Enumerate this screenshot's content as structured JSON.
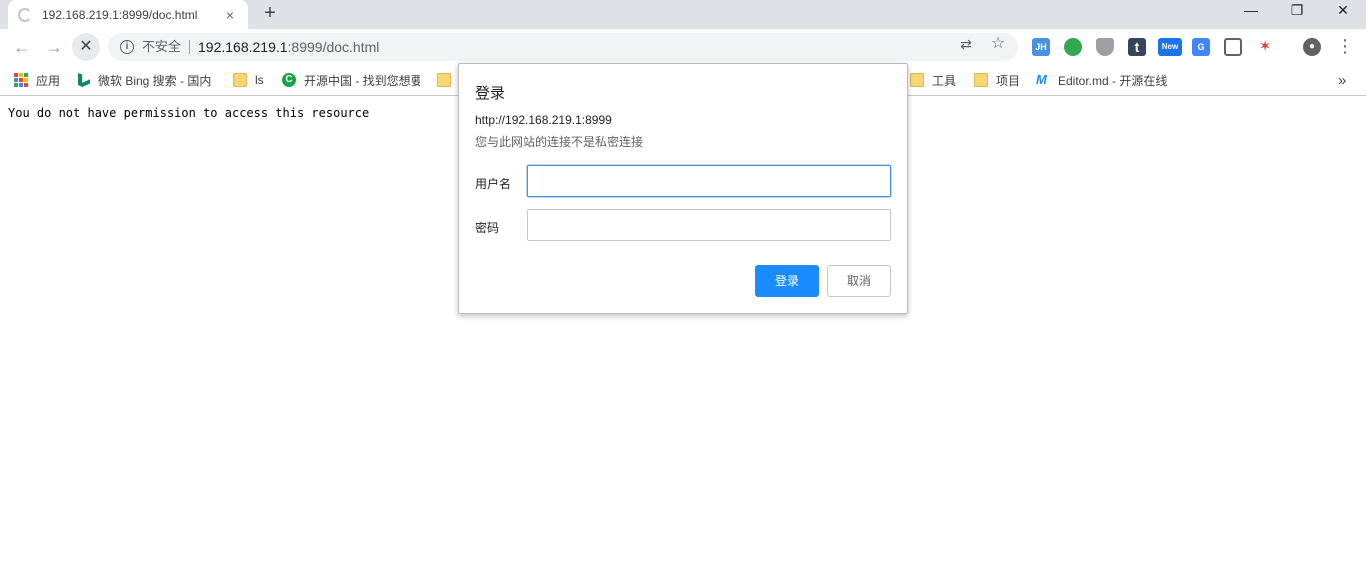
{
  "tab": {
    "title": "192.168.219.1:8999/doc.html",
    "close_icon": "×"
  },
  "new_tab_icon": "+",
  "window_controls": {
    "minimize": "—",
    "restore": "❐",
    "close": "✕"
  },
  "toolbar": {
    "back": "←",
    "forward": "→",
    "stop": "✕",
    "info_icon": "i",
    "insecure_label": "不安全",
    "url_host": "192.168.219.1",
    "url_rest": ":8999/doc.html",
    "translate_icon": "⇄",
    "star_icon": "☆",
    "profile_icon": "●",
    "menu_icon": "⋮"
  },
  "extensions": [
    {
      "name": "jh",
      "text": "JH",
      "color": "#4a90e2"
    },
    {
      "name": "circle",
      "text": "",
      "color": "#34a853"
    },
    {
      "name": "shield",
      "text": "",
      "color": "#9aa0a6"
    },
    {
      "name": "t",
      "text": "t",
      "color": "#35465c"
    },
    {
      "name": "new",
      "text": "New",
      "color": "#1a73e8"
    },
    {
      "name": "translate",
      "text": "G",
      "color": "#4285f4"
    },
    {
      "name": "card",
      "text": "",
      "color": "#5f6368"
    },
    {
      "name": "star",
      "text": "✶",
      "color": "#e8eaed"
    }
  ],
  "bookmarks": [
    {
      "label": "应用"
    },
    {
      "label": "微软 Bing 搜索 - 国内"
    },
    {
      "label": "ls"
    },
    {
      "label": "开源中国 - 找到您想要"
    },
    {
      "label": "工具"
    },
    {
      "label": "项目"
    },
    {
      "label": "Editor.md - 开源在线"
    }
  ],
  "bookmarks_overflow": "»",
  "page": {
    "message": "You do not have permission to access this resource"
  },
  "dialog": {
    "title": "登录",
    "origin": "http://192.168.219.1:8999",
    "warning": "您与此网站的连接不是私密连接",
    "username_label": "用户名",
    "username_value": "",
    "password_label": "密码",
    "password_value": "",
    "login_button": "登录",
    "cancel_button": "取消"
  }
}
